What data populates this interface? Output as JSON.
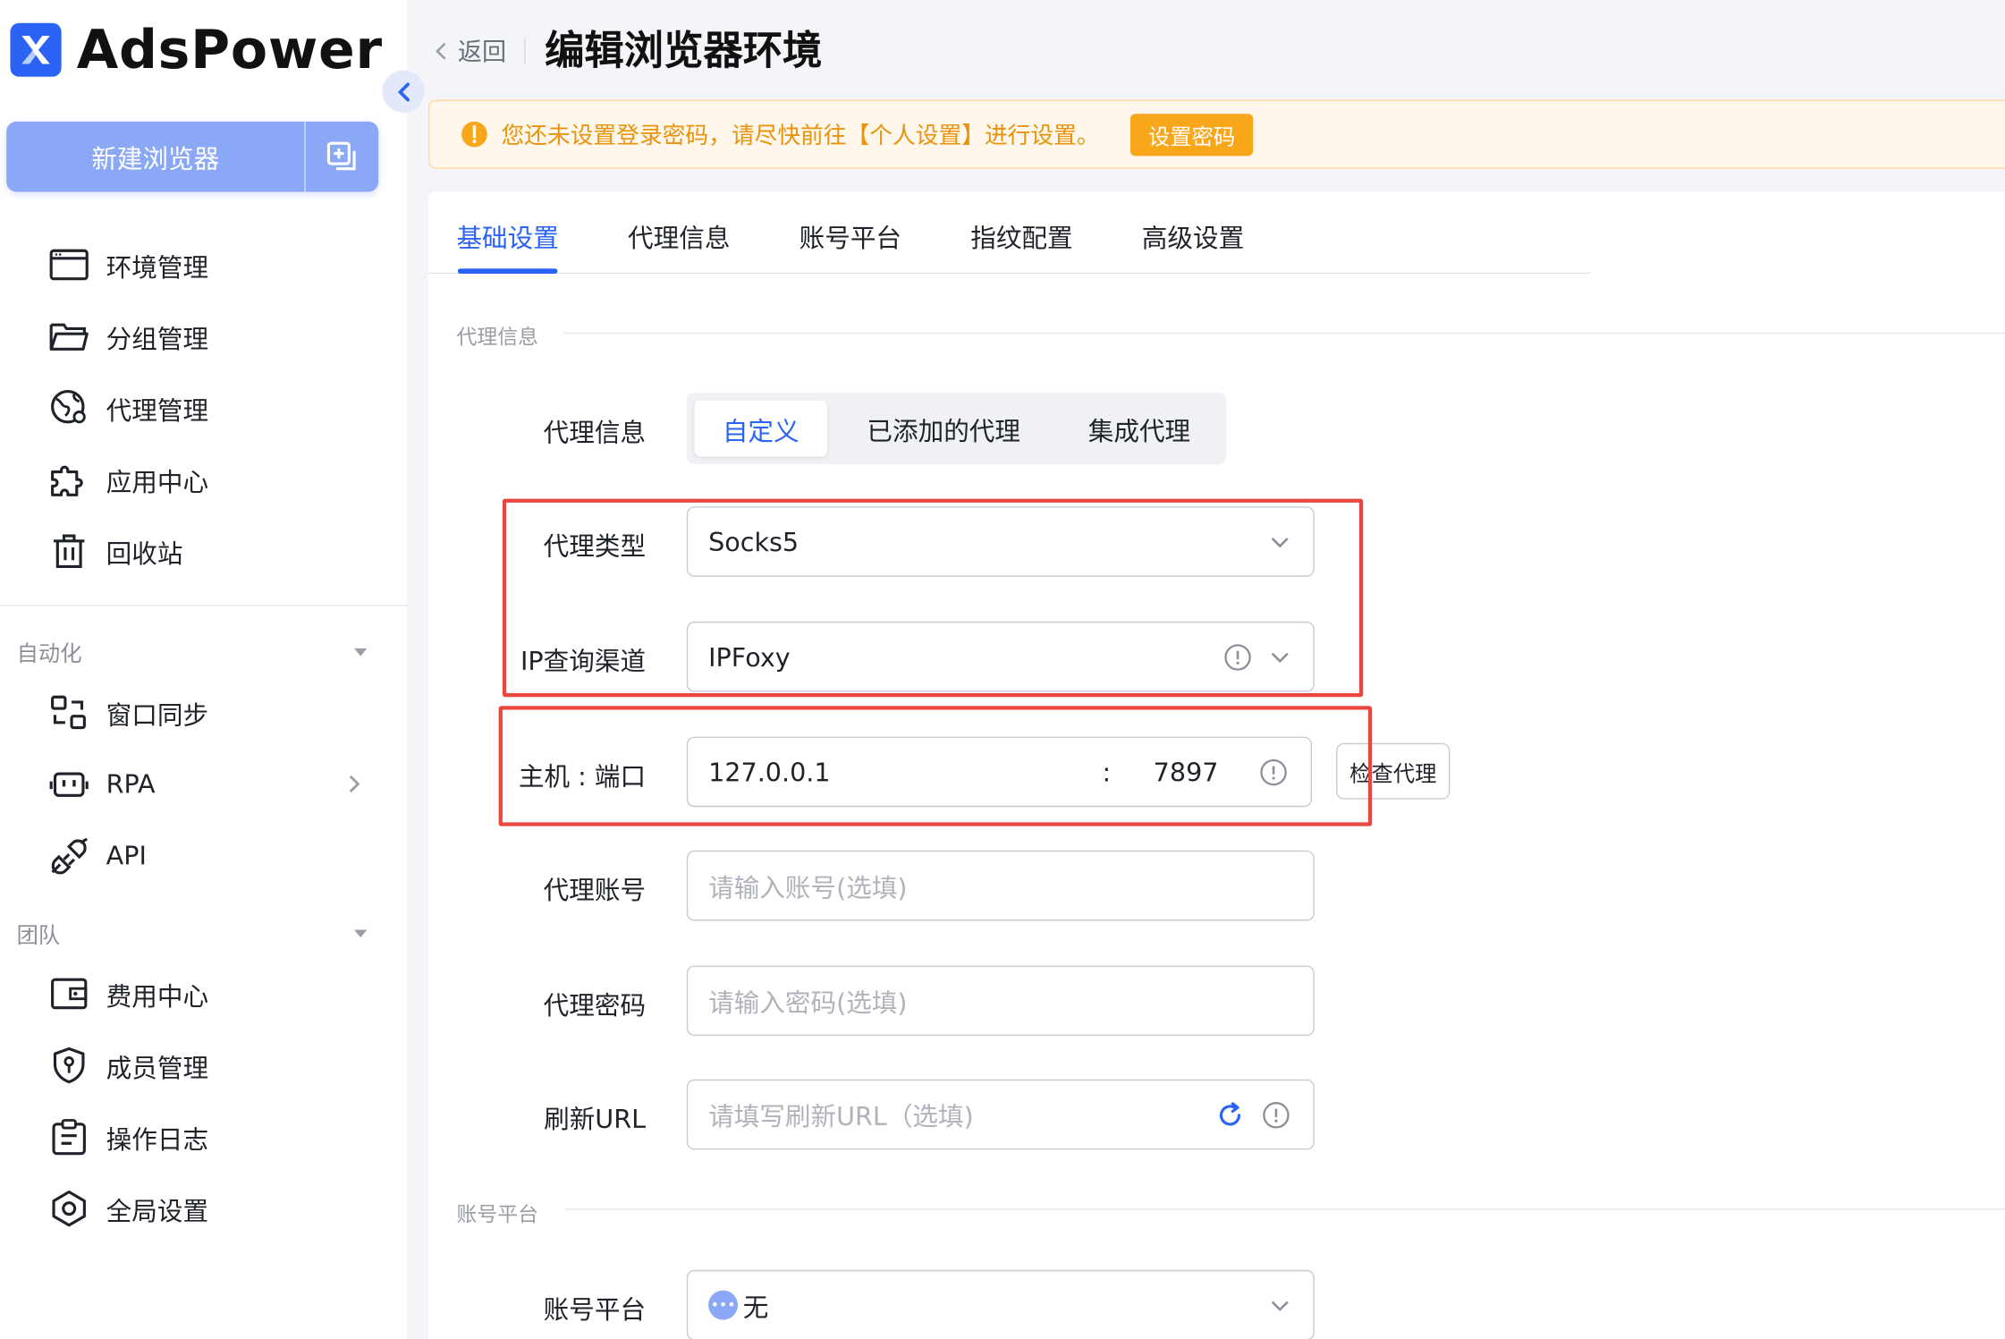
{
  "brand": {
    "name": "AdsPower",
    "accent": "#2b63f5"
  },
  "sidebar": {
    "new_browser_label": "新建浏览器",
    "main_items": [
      {
        "label": "环境管理",
        "icon": "browser-window-icon"
      },
      {
        "label": "分组管理",
        "icon": "folder-open-icon"
      },
      {
        "label": "代理管理",
        "icon": "globe-proxy-icon"
      },
      {
        "label": "应用中心",
        "icon": "puzzle-icon"
      },
      {
        "label": "回收站",
        "icon": "trash-icon"
      }
    ],
    "automation_title": "自动化",
    "automation_items": [
      {
        "label": "窗口同步",
        "icon": "window-sync-icon"
      },
      {
        "label": "RPA",
        "icon": "robot-icon"
      },
      {
        "label": "API",
        "icon": "plug-icon"
      }
    ],
    "team_title": "团队",
    "team_items": [
      {
        "label": "费用中心",
        "icon": "wallet-icon"
      },
      {
        "label": "成员管理",
        "icon": "shield-user-icon"
      },
      {
        "label": "操作日志",
        "icon": "clipboard-icon"
      },
      {
        "label": "全局设置",
        "icon": "hexagon-settings-icon"
      }
    ]
  },
  "header": {
    "back_label": "返回",
    "title": "编辑浏览器环境"
  },
  "notice": {
    "text": "您还未设置登录密码，请尽快前往【个人设置】进行设置。",
    "button_label": "设置密码",
    "color": "#f8a61a"
  },
  "tabs": [
    "基础设置",
    "代理信息",
    "账号平台",
    "指纹配置",
    "高级设置"
  ],
  "active_tab": "基础设置",
  "proxy_section": {
    "section_title": "代理信息",
    "proxy_info_label": "代理信息",
    "proxy_modes": [
      "自定义",
      "已添加的代理",
      "集成代理"
    ],
    "active_mode": "自定义",
    "proxy_type_label": "代理类型",
    "proxy_type_value": "Socks5",
    "ip_channel_label": "IP查询渠道",
    "ip_channel_value": "IPFoxy",
    "host_port_label": "主机 : 端口",
    "host_value": "127.0.0.1",
    "port_separator": ":",
    "port_value": "7897",
    "check_proxy_label": "检查代理",
    "account_label": "代理账号",
    "account_placeholder": "请输入账号(选填)",
    "password_label": "代理密码",
    "password_placeholder": "请输入密码(选填)",
    "refresh_url_label": "刷新URL",
    "refresh_url_placeholder": "请填写刷新URL（选填)"
  },
  "platform_section": {
    "section_title": "账号平台",
    "platform_label": "账号平台",
    "platform_value": "无"
  }
}
